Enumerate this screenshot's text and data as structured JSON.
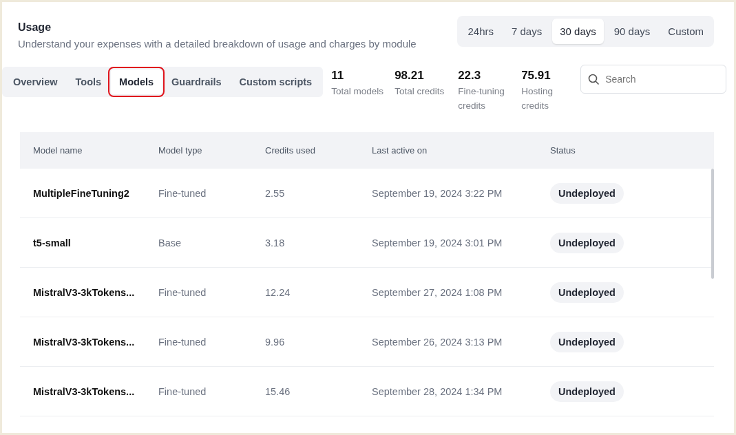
{
  "header": {
    "title": "Usage",
    "subtitle": "Understand your expenses with a detailed breakdown of usage and charges by module"
  },
  "ranges": [
    {
      "label": "24hrs",
      "selected": false
    },
    {
      "label": "7 days",
      "selected": false
    },
    {
      "label": "30 days",
      "selected": true
    },
    {
      "label": "90 days",
      "selected": false
    },
    {
      "label": "Custom",
      "selected": false
    }
  ],
  "tabs": [
    {
      "label": "Overview",
      "selected": false,
      "highlighted": false
    },
    {
      "label": "Tools",
      "selected": false,
      "highlighted": false
    },
    {
      "label": "Models",
      "selected": true,
      "highlighted": true
    },
    {
      "label": "Guardrails",
      "selected": false,
      "highlighted": false
    },
    {
      "label": "Custom scripts",
      "selected": false,
      "highlighted": false
    }
  ],
  "stats": [
    {
      "value": "11",
      "label": "Total models"
    },
    {
      "value": "98.21",
      "label": "Total credits"
    },
    {
      "value": "22.3",
      "label": "Fine-tuning credits"
    },
    {
      "value": "75.91",
      "label": "Hosting credits"
    }
  ],
  "search": {
    "placeholder": "Search"
  },
  "table": {
    "columns": [
      "Model name",
      "Model type",
      "Credits used",
      "Last active on",
      "Status"
    ],
    "rows": [
      {
        "name": "MultipleFineTuning2",
        "type": "Fine-tuned",
        "credits": "2.55",
        "last_active": "September 19, 2024 3:22 PM",
        "status": "Undeployed"
      },
      {
        "name": "t5-small",
        "type": "Base",
        "credits": "3.18",
        "last_active": "September 19, 2024 3:01 PM",
        "status": "Undeployed"
      },
      {
        "name": "MistralV3-3kTokens...",
        "type": "Fine-tuned",
        "credits": "12.24",
        "last_active": "September 27, 2024 1:08 PM",
        "status": "Undeployed"
      },
      {
        "name": "MistralV3-3kTokens...",
        "type": "Fine-tuned",
        "credits": "9.96",
        "last_active": "September 26, 2024 3:13 PM",
        "status": "Undeployed"
      },
      {
        "name": "MistralV3-3kTokens...",
        "type": "Fine-tuned",
        "credits": "15.46",
        "last_active": "September 28, 2024 1:34 PM",
        "status": "Undeployed"
      }
    ]
  }
}
